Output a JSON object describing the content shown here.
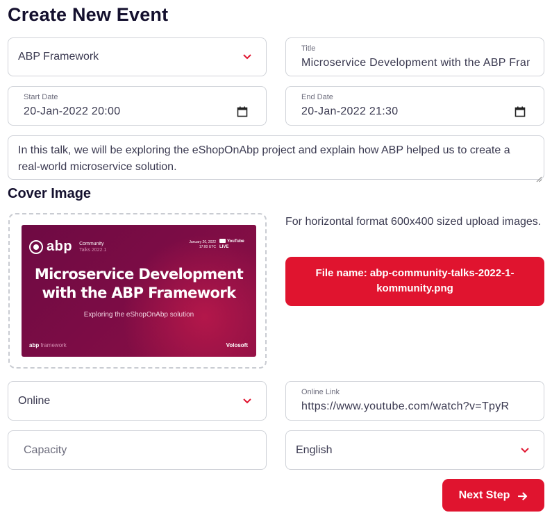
{
  "page": {
    "title": "Create New Event"
  },
  "form": {
    "organizer_select": {
      "value": "ABP Framework"
    },
    "title_field": {
      "label": "Title",
      "value": "Microservice Development with the ABP Framework"
    },
    "start_date": {
      "label": "Start Date",
      "value": "20-Jan-2022 20:00"
    },
    "end_date": {
      "label": "End Date",
      "value": "20-Jan-2022 21:30"
    },
    "description": {
      "value": "In this talk, we will be exploring the eShopOnAbp project and explain how ABP helped us to create a real-world microservice solution."
    },
    "cover": {
      "section_title": "Cover Image",
      "hint": "For horizontal format 600x400 sized upload images.",
      "file_button_label": "File name: abp-community-talks-2022-1-kommunity.png",
      "image": {
        "brand": "abp",
        "series_line1": "Community",
        "series_line2": "Talks 2022.1",
        "date_line1": "January 20, 2022",
        "date_line2": "17:00 UTC",
        "platform_line1": "YouTube",
        "platform_line2": "LIVE",
        "headline": "Microservice Development with the ABP Framework",
        "subtitle": "Exploring the eShopOnAbp solution",
        "footer_left_brand": "abp",
        "footer_left_suffix": "framework",
        "footer_right": "Volosoft"
      }
    },
    "location_type_select": {
      "value": "Online"
    },
    "online_link": {
      "label": "Online Link",
      "value": "https://www.youtube.com/watch?v=TpyR"
    },
    "capacity": {
      "placeholder": "Capacity",
      "value": ""
    },
    "language_select": {
      "value": "English"
    }
  },
  "actions": {
    "next_label": "Next Step"
  },
  "colors": {
    "accent": "#e0142f",
    "text_dark": "#14102e",
    "border": "#cfd2d8"
  },
  "icons": {
    "chevron": "chevron-down-icon",
    "calendar": "calendar-icon",
    "arrow": "arrow-right-icon"
  }
}
